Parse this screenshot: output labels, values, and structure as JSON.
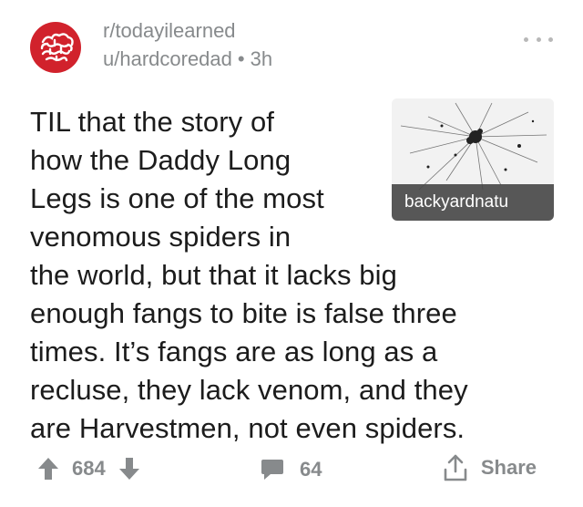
{
  "post": {
    "subreddit": "r/todayilearned",
    "author": "u/hardcoredad",
    "separator": "•",
    "age": "3h",
    "title_lines": [
      "TIL that the story of",
      "how the Daddy Long",
      "Legs is one of the most",
      "venomous spiders in",
      "the world, but that it lacks big",
      "enough fangs to bite is false three",
      "times. It’s fangs are as long as a",
      "recluse, they lack venom, and they",
      "are Harvestmen, not even spiders."
    ],
    "thumbnail": {
      "domain_label": "backyardnatu"
    }
  },
  "actions": {
    "upvotes": "684",
    "comments": "64",
    "share_label": "Share"
  },
  "colors": {
    "avatar": "#d1222c",
    "muted": "#878a8c",
    "title": "#1c1c1c"
  },
  "icons": [
    "brain-icon",
    "more-options-icon",
    "upvote-icon",
    "downvote-icon",
    "comment-icon",
    "share-icon"
  ]
}
